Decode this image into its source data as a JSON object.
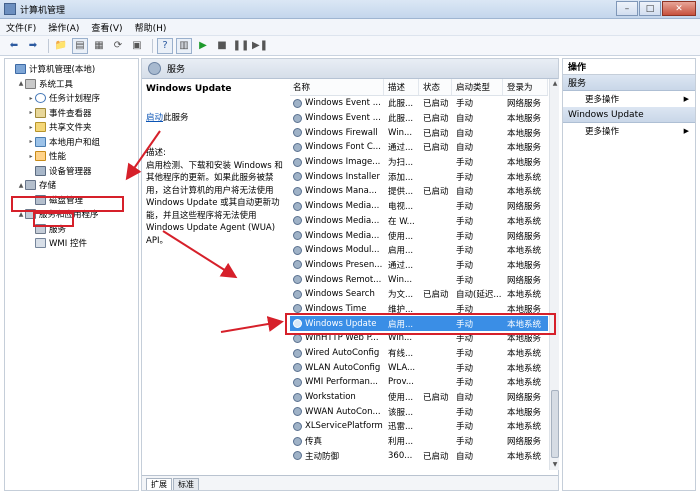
{
  "window": {
    "title": "计算机管理",
    "minimize_glyph": "–",
    "maximize_glyph": "□",
    "close_glyph": "✕"
  },
  "menu": [
    "文件(F)",
    "操作(A)",
    "查看(V)",
    "帮助(H)"
  ],
  "tree": [
    {
      "label": "计算机管理(本地)",
      "level": 0,
      "icon": "computer-icon",
      "expander": ""
    },
    {
      "label": "系统工具",
      "level": 1,
      "icon": "tools-icon",
      "expander": "▲"
    },
    {
      "label": "任务计划程序",
      "level": 2,
      "icon": "clock-icon",
      "expander": "▸"
    },
    {
      "label": "事件查看器",
      "level": 2,
      "icon": "event-log-icon",
      "expander": "▸"
    },
    {
      "label": "共享文件夹",
      "level": 2,
      "icon": "shared-folder-icon",
      "expander": "▸"
    },
    {
      "label": "本地用户和组",
      "level": 2,
      "icon": "users-icon",
      "expander": "▸"
    },
    {
      "label": "性能",
      "level": 2,
      "icon": "performance-icon",
      "expander": "▸"
    },
    {
      "label": "设备管理器",
      "level": 2,
      "icon": "device-manager-icon",
      "expander": ""
    },
    {
      "label": "存储",
      "level": 1,
      "icon": "storage-icon",
      "expander": "▲"
    },
    {
      "label": "磁盘管理",
      "level": 2,
      "icon": "disk-icon",
      "expander": ""
    },
    {
      "label": "服务和应用程序",
      "level": 1,
      "icon": "services-apps-icon",
      "expander": "▲"
    },
    {
      "label": "服务",
      "level": 2,
      "icon": "services-icon",
      "expander": ""
    },
    {
      "label": "WMI 控件",
      "level": 2,
      "icon": "wmi-icon",
      "expander": ""
    }
  ],
  "center": {
    "header": "服务",
    "service_title": "Windows Update",
    "start_link": "启动",
    "start_suffix": "此服务",
    "desc_label": "描述:",
    "desc_text": "启用检测、下载和安装 Windows 和其他程序的更新。如果此服务被禁用，这台计算机的用户将无法使用 Windows Update 或其自动更新功能，并且这些程序将无法使用 Windows Update Agent (WUA) API。"
  },
  "table": {
    "columns": [
      "名称",
      "描述",
      "状态",
      "启动类型",
      "登录为"
    ],
    "rows": [
      {
        "name": "Windows Event ...",
        "desc": "此服...",
        "status": "已启动",
        "start": "手动",
        "logon": "网络服务"
      },
      {
        "name": "Windows Event ...",
        "desc": "此服...",
        "status": "已启动",
        "start": "自动",
        "logon": "本地服务"
      },
      {
        "name": "Windows Firewall",
        "desc": "Win...",
        "status": "已启动",
        "start": "自动",
        "logon": "本地服务"
      },
      {
        "name": "Windows Font C...",
        "desc": "通过...",
        "status": "已启动",
        "start": "自动",
        "logon": "本地服务"
      },
      {
        "name": "Windows Image...",
        "desc": "为扫...",
        "status": "",
        "start": "手动",
        "logon": "本地服务"
      },
      {
        "name": "Windows Installer",
        "desc": "添加...",
        "status": "",
        "start": "手动",
        "logon": "本地系统"
      },
      {
        "name": "Windows Mana...",
        "desc": "提供...",
        "status": "已启动",
        "start": "自动",
        "logon": "本地系统"
      },
      {
        "name": "Windows Media...",
        "desc": "电视...",
        "status": "",
        "start": "手动",
        "logon": "网络服务"
      },
      {
        "name": "Windows Media...",
        "desc": "在 W...",
        "status": "",
        "start": "手动",
        "logon": "本地系统"
      },
      {
        "name": "Windows Media...",
        "desc": "使用...",
        "status": "",
        "start": "手动",
        "logon": "网络服务"
      },
      {
        "name": "Windows Modul...",
        "desc": "启用...",
        "status": "",
        "start": "手动",
        "logon": "本地系统"
      },
      {
        "name": "Windows Presen...",
        "desc": "通过...",
        "status": "",
        "start": "手动",
        "logon": "本地服务"
      },
      {
        "name": "Windows Remot...",
        "desc": "Win...",
        "status": "",
        "start": "手动",
        "logon": "网络服务"
      },
      {
        "name": "Windows Search",
        "desc": "为文...",
        "status": "已启动",
        "start": "自动(延迟...",
        "logon": "本地系统"
      },
      {
        "name": "Windows Time",
        "desc": "维护...",
        "status": "",
        "start": "手动",
        "logon": "本地服务"
      },
      {
        "name": "Windows Update",
        "desc": "启用...",
        "status": "",
        "start": "手动",
        "logon": "本地系统",
        "selected": true
      },
      {
        "name": "WinHTTP Web P...",
        "desc": "Win...",
        "status": "",
        "start": "手动",
        "logon": "本地服务"
      },
      {
        "name": "Wired AutoConfig",
        "desc": "有线...",
        "status": "",
        "start": "手动",
        "logon": "本地系统"
      },
      {
        "name": "WLAN AutoConfig",
        "desc": "WLA...",
        "status": "",
        "start": "手动",
        "logon": "本地系统"
      },
      {
        "name": "WMI Performan...",
        "desc": "Prov...",
        "status": "",
        "start": "手动",
        "logon": "本地系统"
      },
      {
        "name": "Workstation",
        "desc": "使用...",
        "status": "已启动",
        "start": "自动",
        "logon": "网络服务"
      },
      {
        "name": "WWAN AutoCon...",
        "desc": "该服...",
        "status": "",
        "start": "手动",
        "logon": "本地服务"
      },
      {
        "name": "XLServicePlatform",
        "desc": "迅雷...",
        "status": "",
        "start": "手动",
        "logon": "本地系统"
      },
      {
        "name": "传真",
        "desc": "利用...",
        "status": "",
        "start": "手动",
        "logon": "网络服务"
      },
      {
        "name": "主动防御",
        "desc": "360...",
        "status": "已启动",
        "start": "自动",
        "logon": "本地系统"
      }
    ]
  },
  "tabs": [
    "扩展",
    "标准"
  ],
  "actions": {
    "header": "操作",
    "section1": "服务",
    "more1": "更多操作",
    "section2": "Windows Update",
    "more2": "更多操作",
    "arrow": "▶"
  },
  "colors": {
    "annotation_red": "#d6202a",
    "selection_blue": "#3a8ee6"
  }
}
